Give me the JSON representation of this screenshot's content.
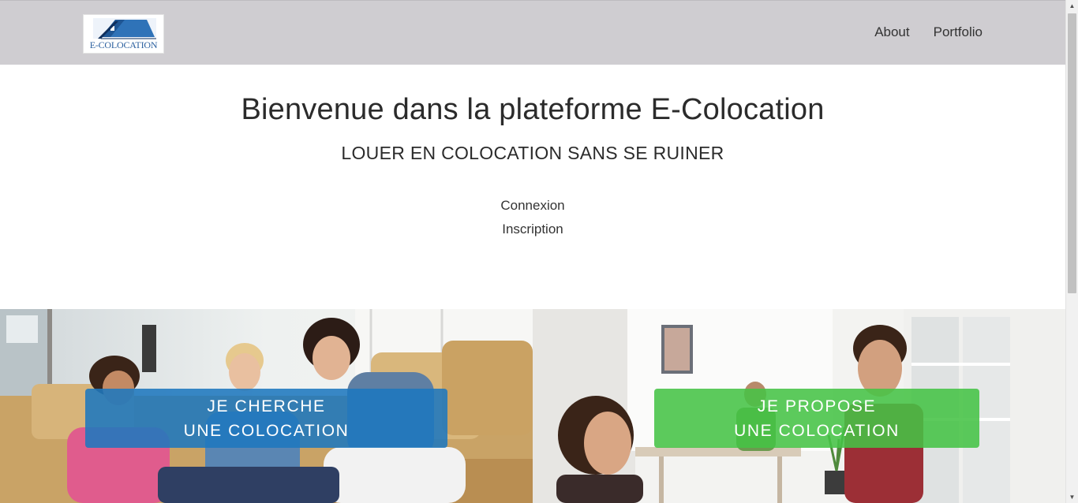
{
  "header": {
    "logo_text": "E-COLOCATION",
    "nav": [
      {
        "label": "About"
      },
      {
        "label": "Portfolio"
      }
    ]
  },
  "hero": {
    "title": "Bienvenue dans la plateforme E-Colocation",
    "subtitle": "LOUER EN COLOCATION SANS SE RUINER",
    "login_label": "Connexion",
    "register_label": "Inscription"
  },
  "panels": {
    "seek": {
      "line1": "JE CHERCHE",
      "line2": "UNE COLOCATION",
      "color": "#1e78be"
    },
    "offer": {
      "line1": "JE PROPOSE",
      "line2": "UNE COLOCATION",
      "color": "#46c346"
    }
  },
  "theme": {
    "navbar_bg": "#cfcdd1",
    "logo_blue": "#2a5f9e"
  },
  "icons": {
    "scroll_up": "scroll-up-arrow-icon",
    "scroll_down": "scroll-down-arrow-icon"
  }
}
